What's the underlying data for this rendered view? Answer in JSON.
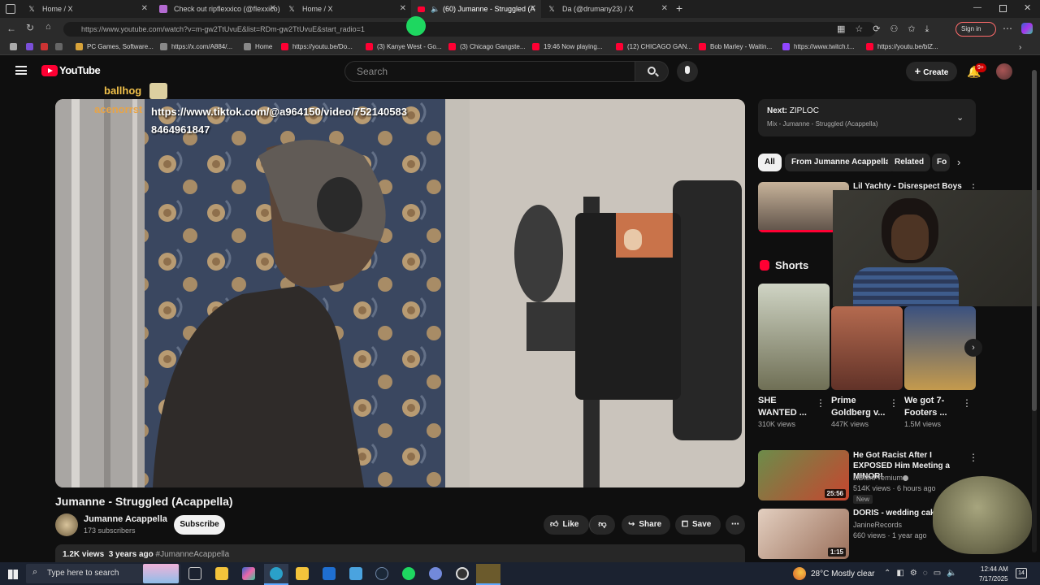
{
  "browser": {
    "tabs": [
      {
        "title": "Home / X",
        "icon": "x-logo"
      },
      {
        "title": "Check out ripflexxico (@flexxico)",
        "icon": "twitch-logo"
      },
      {
        "title": "Home / X",
        "icon": "x-logo"
      },
      {
        "title": "(60) Jumanne - Struggled (A",
        "icon": "youtube-logo"
      },
      {
        "title": "Da (@drumany23) / X",
        "icon": "x-logo"
      }
    ],
    "url": "https://www.youtube.com/watch?v=m-gw2TtUvuE&list=RDm-gw2TtUvuE&start_radio=1",
    "sign_in": "Sign in",
    "bookmarks": [
      "PC Games, Software...",
      "https://x.com/A884/...",
      "Home",
      "https://youtu.be/Do...",
      "(3) Kanye West - Go...",
      "(3) Chicago Gangste...",
      "19:46 Now playing...",
      "(12) CHICAGO GAN...",
      "Bob Marley - Waitin...",
      "https://www.twitch.t...",
      "https://youtu.be/blZ..."
    ]
  },
  "youtube": {
    "logo": "YouTube",
    "search_placeholder": "Search",
    "create_label": "Create",
    "notif_count": "9+"
  },
  "overlay": {
    "user1": "ballhog",
    "user2": "acenorrst",
    "message": "https://www.tiktok.com/@a964150/video/7521405838464961847"
  },
  "video": {
    "title": "Jumanne - Struggled (Acappella)",
    "channel": "Jumanne Acappella",
    "subscribers": "173 subscribers",
    "subscribe_label": "Subscribe",
    "like_label": "Like",
    "share_label": "Share",
    "save_label": "Save",
    "views": "1.2K views",
    "age": "3 years ago",
    "hashtag": "#JumanneAcappella"
  },
  "sidebar": {
    "next_prefix": "Next:",
    "next_title": "ZIPLOC",
    "next_sub": "Mix - Jumanne - Struggled (Acappella)",
    "chips": [
      "All",
      "From Jumanne Acappella",
      "Related",
      "Fo"
    ],
    "first_video": "Lil Yachty - Disrespect Boys",
    "shorts_label": "Shorts",
    "shorts": [
      {
        "title": "SHE WANTED ...",
        "views": "310K views"
      },
      {
        "title": "Prime Goldberg v...",
        "views": "447K views"
      },
      {
        "title": "We got 7-Footers ...",
        "views": "1.5M views"
      }
    ],
    "videos": [
      {
        "title": "He Got Racist After I EXPOSED Him Meeting a MINOR!",
        "channel": "JiDionPremium",
        "meta": "514K views · 6 hours ago",
        "badge": "New",
        "duration": "25:56"
      },
      {
        "title": "DORIS - wedding cake",
        "channel": "JanineRecords",
        "meta": "660 views · 1 year ago",
        "badge": "",
        "duration": "1:15"
      }
    ]
  },
  "taskbar": {
    "search_placeholder": "Type here to search",
    "weather": "28°C  Mostly clear",
    "time": "12:44 AM",
    "date": "7/17/2025",
    "notif": "14"
  },
  "colors": {
    "accent_red": "#ff0033",
    "bg": "#0f0f0f",
    "spotify_green": "#1ed760"
  }
}
